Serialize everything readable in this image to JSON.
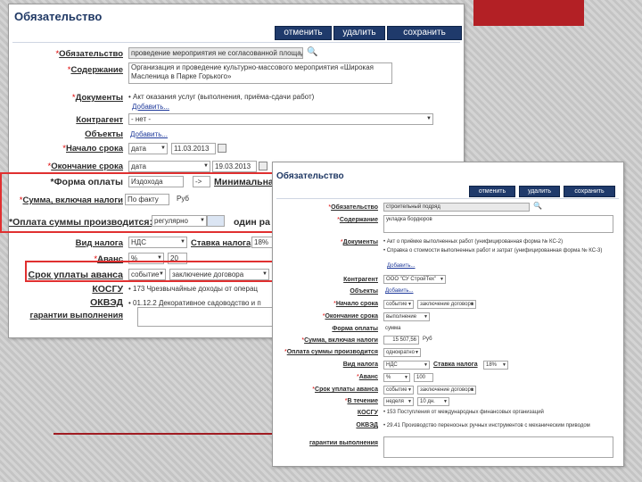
{
  "w1": {
    "title": "Обязательство",
    "buttons": {
      "cancel": "отменить",
      "delete": "удалить",
      "save": "сохранить"
    },
    "labels": {
      "obligation": "Обязательство",
      "content": "Содержание",
      "documents": "Документы",
      "counterparty": "Контрагент",
      "objects": "Объекты",
      "start": "Начало срока",
      "end": "Окончание срока",
      "payment_form": "*Форма оплаты",
      "minimal": "Минимальна",
      "sum": "Сумма, включая налоги",
      "payment_when": "*Оплата суммы производится:",
      "one_ra": "один ра",
      "tax_type": "Вид налога",
      "tax_rate": "Ставка налога",
      "advance": "Аванс",
      "adv_term": "Срок уплаты аванса",
      "kosgu": "КОСГУ",
      "okved": "ОКВЭД",
      "guarantee": "гарантии выполнения"
    },
    "values": {
      "obligation": "проведение мероприятия не согласованной площадке",
      "content": "Организация и проведение культурно-массового мероприятия «Широкая Масленица в Парке Горького»",
      "documents": "Акт оказания услуг (выполнения, приёма-сдачи работ)",
      "add": "Добавить...",
      "counterparty": "- нет -",
      "start_type": "дата",
      "start_date": "11.03.2013",
      "end_type": "дата",
      "end_date": "19.03.2013",
      "payment_form": "Издохода",
      "payment_form2": "->",
      "sum": "По факту",
      "rub": "Руб",
      "payment_when": "регулярно",
      "tax_type": "НДС",
      "tax_rate": "18%",
      "advance_unit": "%",
      "advance_val": "20",
      "adv_term_type": "событие",
      "adv_term_event": "заключение договора",
      "kosgu": "173 Чрезвычайные доходы от операц",
      "okved": "01.12.2 Декоративное садоводство и п"
    }
  },
  "w2": {
    "title": "Обязательство",
    "buttons": {
      "cancel": "отменить",
      "delete": "удалить",
      "save": "сохранить"
    },
    "labels": {
      "obligation": "Обязательство",
      "content": "Содержание",
      "documents": "Документы",
      "counterparty": "Контрагент",
      "objects": "Объекты",
      "start": "Начало срока",
      "end": "Окончание срока",
      "payment_form": "Форма оплаты",
      "sum": "Сумма, включая налоги",
      "payment_when": "Оплата суммы производится",
      "tax_type": "Вид налога",
      "tax_rate": "Ставка налога",
      "advance": "Аванс",
      "adv_term": "Срок уплаты аванса",
      "within": "В течение",
      "kosgu": "КОСГУ",
      "okved": "ОКВЭД",
      "guarantee": "гарантии выполнения"
    },
    "values": {
      "obligation": "строительный подряд",
      "content": "укладка бордюров",
      "doc1": "Акт о приёмке выполненных работ (унифицированная форма № КС-2)",
      "doc2": "Справка о стоимости выполненных работ и затрат (унифицированная форма № КС-3)",
      "add": "Добавить...",
      "counterparty": "ООО \"СУ СтройТех\"",
      "start_type": "событие",
      "start_event": "заключение договора",
      "end_type": "выполнение",
      "payment_form": "сумма",
      "sum": "15 507,56",
      "rub": "Руб",
      "payment_when": "однократно",
      "tax_type": "НДС",
      "tax_rate": "18%",
      "advance_unit": "%",
      "advance_val": "100",
      "adv_term_type": "событие",
      "adv_term_event": "заключение договора",
      "within_unit": "неделя",
      "within_val": "10 дн.",
      "kosgu": "153 Поступления от международных финансовых организаций",
      "okved": "29.41 Производство переносных ручных инструментов с механическим приводом"
    }
  }
}
